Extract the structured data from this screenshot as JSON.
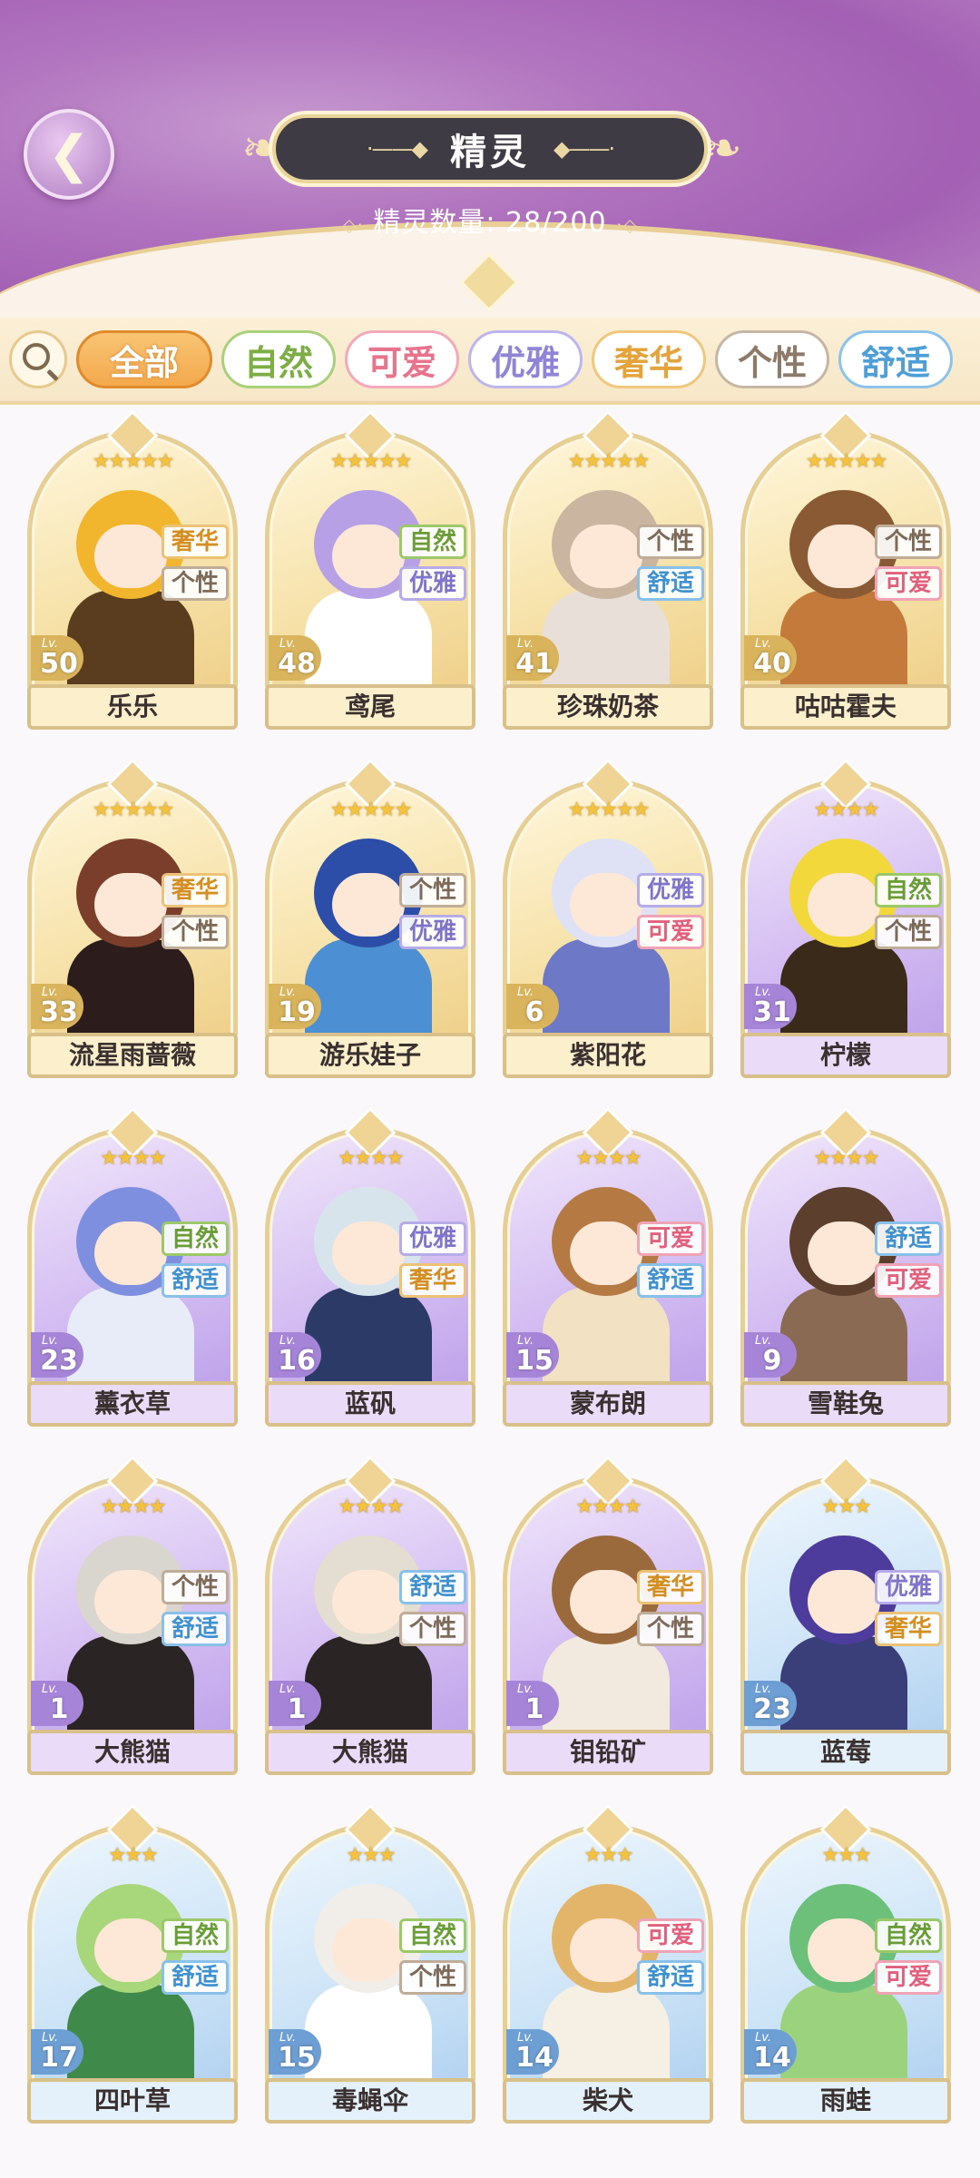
{
  "header": {
    "title": "精灵",
    "count_label": "精灵数量: 28/200"
  },
  "filters": [
    {
      "label": "全部",
      "active": true,
      "color": "#f4a94d",
      "border": "#e08a2c"
    },
    {
      "label": "自然",
      "active": false,
      "color": "#7cae45",
      "border": "#a9d07a"
    },
    {
      "label": "可爱",
      "active": false,
      "color": "#e8738d",
      "border": "#f3a9b9"
    },
    {
      "label": "优雅",
      "active": false,
      "color": "#8f84d6",
      "border": "#bdb6ee"
    },
    {
      "label": "奢华",
      "active": false,
      "color": "#e3a43d",
      "border": "#f0c77d"
    },
    {
      "label": "个性",
      "active": false,
      "color": "#8d7a68",
      "border": "#c6b6a4"
    },
    {
      "label": "舒适",
      "active": false,
      "color": "#4e9fd8",
      "border": "#8cc3ec"
    }
  ],
  "tag_colors": {
    "自然": {
      "text": "#6a9d36",
      "border": "#9cc86a"
    },
    "可爱": {
      "text": "#e0607d",
      "border": "#f0a3b4"
    },
    "优雅": {
      "text": "#7e74c9",
      "border": "#b5ace8"
    },
    "奢华": {
      "text": "#d48f23",
      "border": "#ecc277"
    },
    "个性": {
      "text": "#7d6a58",
      "border": "#c0ad99"
    },
    "舒适": {
      "text": "#3f92cf",
      "border": "#88c0ea"
    }
  },
  "spirits": [
    {
      "name": "乐乐",
      "level": "50",
      "stars": 5,
      "rarity": "gold",
      "tags": [
        "奢华",
        "个性"
      ],
      "hair": "#f2b62e",
      "outfit": "#5a3d1e"
    },
    {
      "name": "鸢尾",
      "level": "48",
      "stars": 5,
      "rarity": "gold",
      "tags": [
        "自然",
        "优雅"
      ],
      "hair": "#b8a0e6",
      "outfit": "#ffffff"
    },
    {
      "name": "珍珠奶茶",
      "level": "41",
      "stars": 5,
      "rarity": "gold",
      "tags": [
        "个性",
        "舒适"
      ],
      "hair": "#c9b5a0",
      "outfit": "#e8e0d8"
    },
    {
      "name": "咕咕霍夫",
      "level": "40",
      "stars": 5,
      "rarity": "gold",
      "tags": [
        "个性",
        "可爱"
      ],
      "hair": "#8a5a34",
      "outfit": "#c47a3a"
    },
    {
      "name": "流星雨蔷薇",
      "level": "33",
      "stars": 5,
      "rarity": "gold",
      "tags": [
        "奢华",
        "个性"
      ],
      "hair": "#7a3e2a",
      "outfit": "#2c1c1c"
    },
    {
      "name": "游乐娃子",
      "level": "19",
      "stars": 5,
      "rarity": "gold",
      "tags": [
        "个性",
        "优雅"
      ],
      "hair": "#2c4ea8",
      "outfit": "#4c8fd2"
    },
    {
      "name": "紫阳花",
      "level": "6",
      "stars": 5,
      "rarity": "gold",
      "tags": [
        "优雅",
        "可爱"
      ],
      "hair": "#dfe2f4",
      "outfit": "#6d79c6"
    },
    {
      "name": "柠檬",
      "level": "31",
      "stars": 4,
      "rarity": "purple",
      "tags": [
        "自然",
        "个性"
      ],
      "hair": "#f2d83a",
      "outfit": "#3a2a1a"
    },
    {
      "name": "薰衣草",
      "level": "23",
      "stars": 4,
      "rarity": "purple",
      "tags": [
        "自然",
        "舒适"
      ],
      "hair": "#7f8fe0",
      "outfit": "#e8ecf8"
    },
    {
      "name": "蓝矾",
      "level": "16",
      "stars": 4,
      "rarity": "purple",
      "tags": [
        "优雅",
        "奢华"
      ],
      "hair": "#d8e4ec",
      "outfit": "#2b3a66"
    },
    {
      "name": "蒙布朗",
      "level": "15",
      "stars": 4,
      "rarity": "purple",
      "tags": [
        "可爱",
        "舒适"
      ],
      "hair": "#b57a44",
      "outfit": "#f3e1c4"
    },
    {
      "name": "雪鞋兔",
      "level": "9",
      "stars": 4,
      "rarity": "purple",
      "tags": [
        "舒适",
        "可爱"
      ],
      "hair": "#5c3f2c",
      "outfit": "#8a6a52"
    },
    {
      "name": "大熊猫",
      "level": "1",
      "stars": 4,
      "rarity": "purple",
      "tags": [
        "个性",
        "舒适"
      ],
      "hair": "#d9d5cf",
      "outfit": "#2a2424"
    },
    {
      "name": "大熊猫",
      "level": "1",
      "stars": 4,
      "rarity": "purple",
      "tags": [
        "舒适",
        "个性"
      ],
      "hair": "#e4ddd2",
      "outfit": "#2a2424"
    },
    {
      "name": "钼铅矿",
      "level": "1",
      "stars": 4,
      "rarity": "purple",
      "tags": [
        "奢华",
        "个性"
      ],
      "hair": "#9a6a3c",
      "outfit": "#f2eadf"
    },
    {
      "name": "蓝莓",
      "level": "23",
      "stars": 3,
      "rarity": "blue",
      "tags": [
        "优雅",
        "奢华"
      ],
      "hair": "#4e3c9c",
      "outfit": "#3a3f7a"
    },
    {
      "name": "四叶草",
      "level": "17",
      "stars": 3,
      "rarity": "blue",
      "tags": [
        "自然",
        "舒适"
      ],
      "hair": "#a8d67a",
      "outfit": "#3f8a4a"
    },
    {
      "name": "毒蝇伞",
      "level": "15",
      "stars": 3,
      "rarity": "blue",
      "tags": [
        "自然",
        "个性"
      ],
      "hair": "#f1ede8",
      "outfit": "#ffffff"
    },
    {
      "name": "柴犬",
      "level": "14",
      "stars": 3,
      "rarity": "blue",
      "tags": [
        "可爱",
        "舒适"
      ],
      "hair": "#e3b56a",
      "outfit": "#f6efe4"
    },
    {
      "name": "雨蛙",
      "level": "14",
      "stars": 3,
      "rarity": "blue",
      "tags": [
        "自然",
        "可爱"
      ],
      "hair": "#6cc07a",
      "outfit": "#9bd27e"
    }
  ]
}
